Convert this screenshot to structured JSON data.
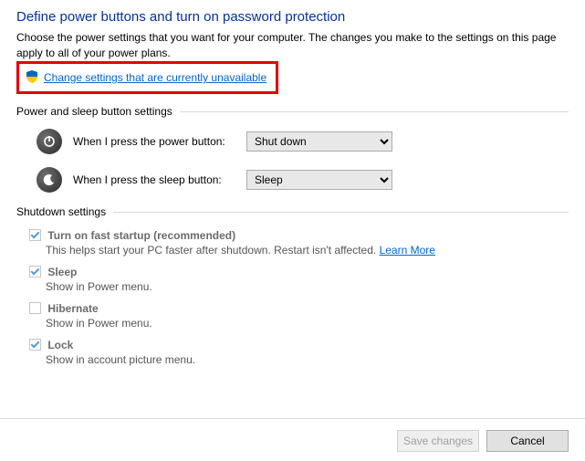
{
  "title": "Define power buttons and turn on password protection",
  "description": "Choose the power settings that you want for your computer. The changes you make to the settings on this page apply to all of your power plans.",
  "change_link": "Change settings that are currently unavailable",
  "section1": "Power and sleep button settings",
  "power_row": {
    "label": "When I press the power button:",
    "value": "Shut down"
  },
  "sleep_row": {
    "label": "When I press the sleep button:",
    "value": "Sleep"
  },
  "section2": "Shutdown settings",
  "opts": {
    "fast": {
      "label": "Turn on fast startup (recommended)",
      "sub": "This helps start your PC faster after shutdown. Restart isn't affected. ",
      "learn": "Learn More"
    },
    "sleep": {
      "label": "Sleep",
      "sub": "Show in Power menu."
    },
    "hibernate": {
      "label": "Hibernate",
      "sub": "Show in Power menu."
    },
    "lock": {
      "label": "Lock",
      "sub": "Show in account picture menu."
    }
  },
  "buttons": {
    "save": "Save changes",
    "cancel": "Cancel"
  }
}
